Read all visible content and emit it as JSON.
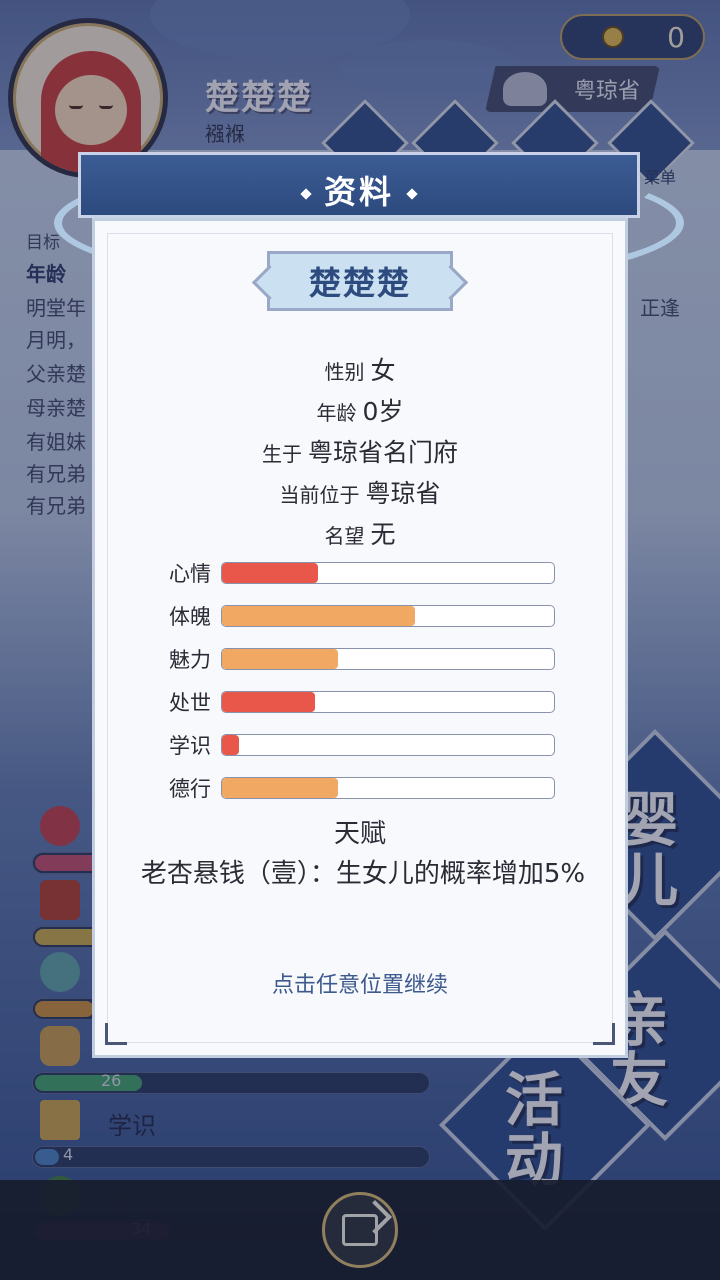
{
  "background": {
    "character_name": "楚楚楚",
    "character_stage": "襁褓",
    "coin_count": "0",
    "location": "粤琼省",
    "menu_suffix": "菜单",
    "text_lines": [
      "目标",
      "年龄",
      "明堂年",
      "月明，",
      "父亲楚",
      "母亲楚",
      "有姐妹",
      "有兄弟",
      "有兄弟"
    ],
    "text_right": "正逢",
    "stats": [
      {
        "name": "",
        "value": "",
        "level": 0.2,
        "color": "#c24a6b"
      },
      {
        "name": "",
        "value": "",
        "level": 0.25,
        "color": "#c9a64a"
      },
      {
        "name": "",
        "value": "",
        "level": 0.15,
        "color": "#c98b3a"
      },
      {
        "name": "",
        "value": "26",
        "level": 0.27,
        "color": "#3f9f6a"
      },
      {
        "name": "学识",
        "value": "4",
        "level": 0.04,
        "color": "#4a7fbf"
      },
      {
        "name": "德行",
        "value": "34",
        "level": 0.34,
        "color": "#8a3fae"
      }
    ],
    "tiles": [
      "婴儿",
      "亲友",
      "活动"
    ]
  },
  "dialog": {
    "title": "资料",
    "name": "楚楚楚",
    "gender": {
      "label": "性别",
      "value": "女"
    },
    "age": {
      "label": "年龄",
      "value": "0岁"
    },
    "birthplace": {
      "label": "生于",
      "value": "粤琼省名门府"
    },
    "current_location": {
      "label": "当前位于",
      "value": "粤琼省"
    },
    "reputation": {
      "label": "名望",
      "value": "无"
    },
    "stats": [
      {
        "label": "心情",
        "level": 0.29,
        "color": "#e8574a"
      },
      {
        "label": "体魄",
        "level": 0.58,
        "color": "#f0a862"
      },
      {
        "label": "魅力",
        "level": 0.35,
        "color": "#f0a862"
      },
      {
        "label": "处世",
        "level": 0.28,
        "color": "#e8574a"
      },
      {
        "label": "学识",
        "level": 0.05,
        "color": "#e8574a"
      },
      {
        "label": "德行",
        "level": 0.35,
        "color": "#f0a862"
      }
    ],
    "talent_title": "天赋",
    "talent_desc": "老杏悬钱（壹）：生女儿的概率增加5%",
    "continue_hint": "点击任意位置继续"
  }
}
